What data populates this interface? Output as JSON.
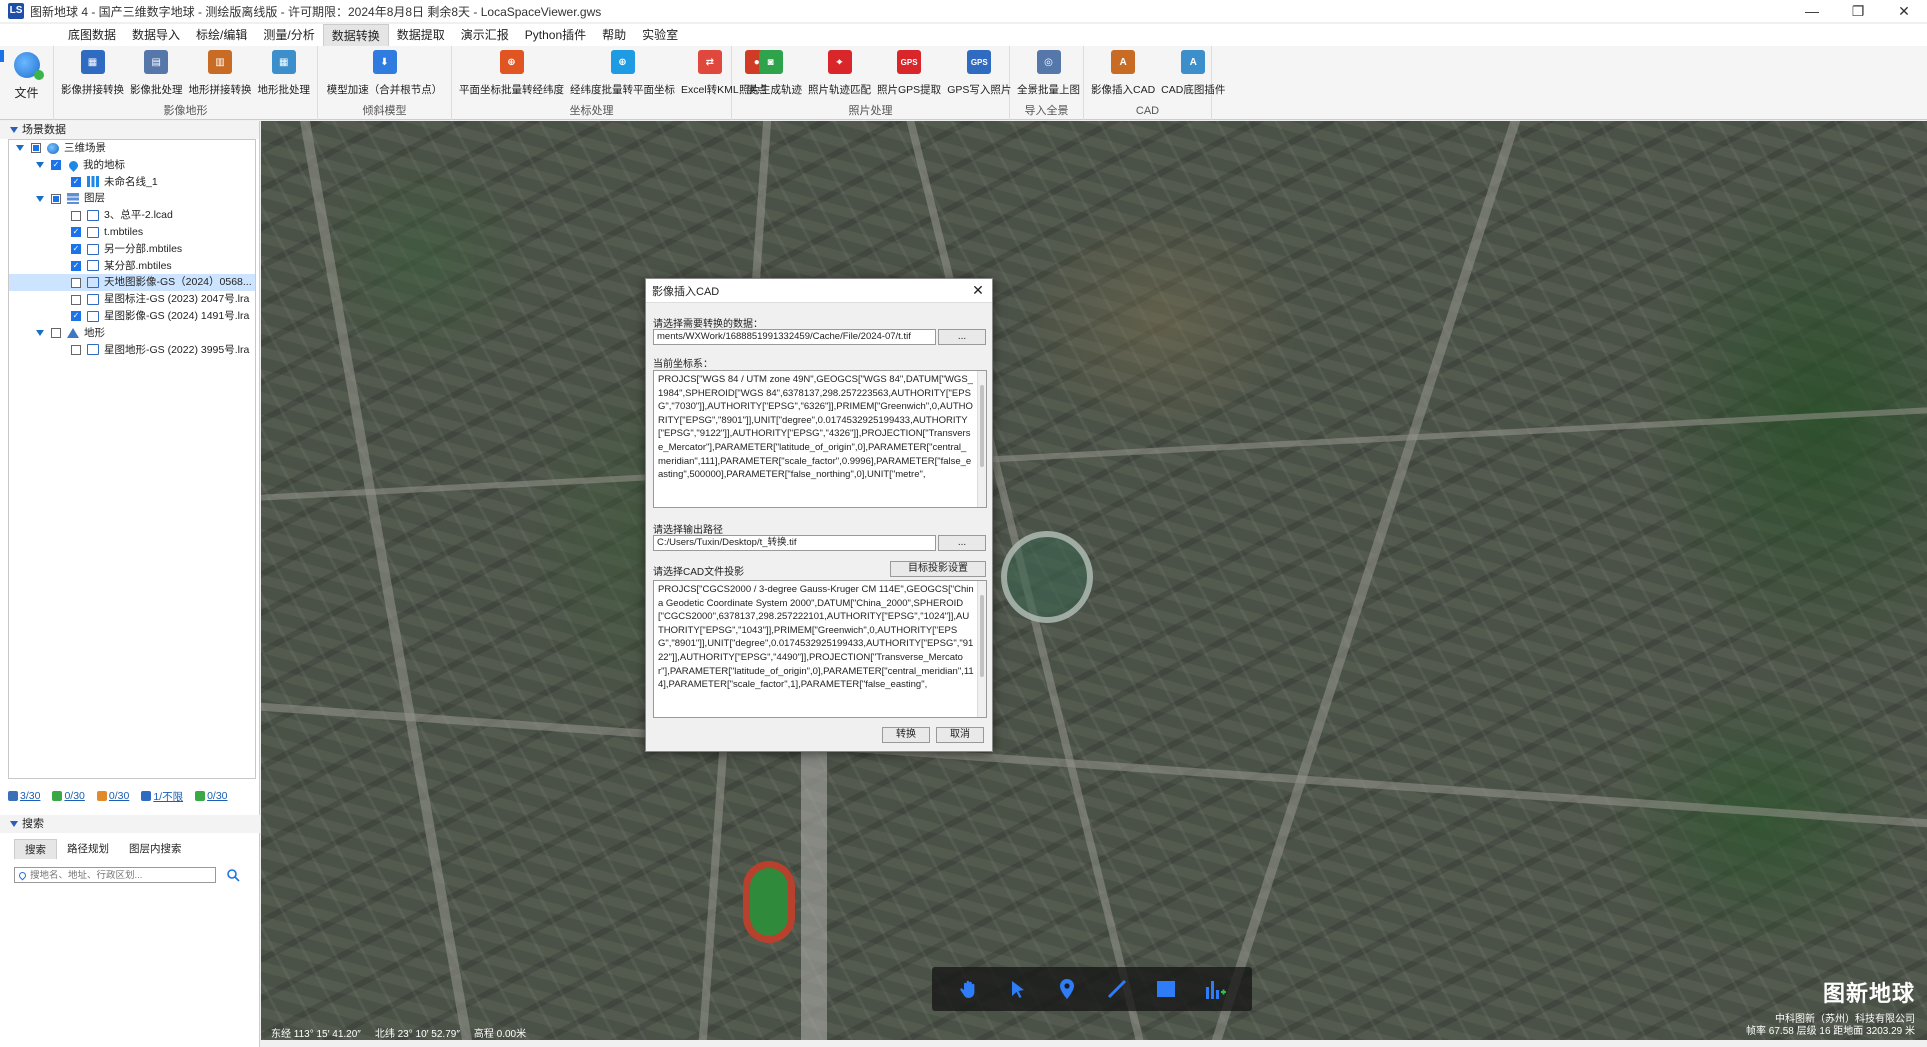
{
  "window": {
    "title": "图新地球 4 - 国产三维数字地球 - 测绘版离线版 - 许可期限：2024年8月8日 剩余8天 - LocaSpaceViewer.gws",
    "app_icon": "LS"
  },
  "menu": {
    "tabs": [
      "底图数据",
      "数据导入",
      "标绘/编辑",
      "测量/分析",
      "数据转换",
      "数据提取",
      "演示汇报",
      "Python插件",
      "帮助",
      "实验室"
    ],
    "active": "数据转换"
  },
  "ribbon": {
    "file_label": "文件",
    "groups": [
      {
        "name": "影像地形",
        "buttons": [
          "影像拼接转换",
          "影像批处理",
          "地形拼接转换",
          "地形批处理"
        ]
      },
      {
        "name": "倾斜模型",
        "buttons": [
          "模型加速（合并根节点）"
        ]
      },
      {
        "name": "坐标处理",
        "buttons": [
          "平面坐标批量转经纬度",
          "经纬度批量转平面坐标",
          "Excel转KML",
          "展点"
        ]
      },
      {
        "name": "照片处理",
        "buttons": [
          "照片生成轨迹",
          "照片轨迹匹配",
          "照片GPS提取",
          "GPS写入照片"
        ]
      },
      {
        "name": "导入全景",
        "buttons": [
          "全景批量上图"
        ]
      },
      {
        "name": "CAD",
        "buttons": [
          "影像插入CAD",
          "CAD底图插件"
        ]
      }
    ]
  },
  "left_panel": {
    "section_title": "场景数据",
    "tree": [
      {
        "label": "三维场景",
        "level": 0,
        "check": "partial",
        "icon": "globe",
        "expanded": true
      },
      {
        "label": "我的地标",
        "level": 1,
        "check": "checked",
        "icon": "pin",
        "expanded": true
      },
      {
        "label": "未命名线_1",
        "level": 2,
        "check": "checked",
        "icon": "bars"
      },
      {
        "label": "图层",
        "level": 1,
        "check": "partial",
        "icon": "stack",
        "expanded": true
      },
      {
        "label": "3、总平-2.lcad",
        "level": 2,
        "check": "unchecked",
        "icon": "layer"
      },
      {
        "label": "t.mbtiles",
        "level": 2,
        "check": "checked",
        "icon": "layer"
      },
      {
        "label": "另一分部.mbtiles",
        "level": 2,
        "check": "checked",
        "icon": "layer"
      },
      {
        "label": "某分部.mbtiles",
        "level": 2,
        "check": "checked",
        "icon": "layer"
      },
      {
        "label": "天地图影像-GS（2024）0568...",
        "level": 2,
        "check": "unchecked",
        "icon": "layer",
        "selected": true
      },
      {
        "label": "星图标注-GS (2023) 2047号.lra",
        "level": 2,
        "check": "unchecked",
        "icon": "layer"
      },
      {
        "label": "星图影像-GS (2024) 1491号.lra",
        "level": 2,
        "check": "checked",
        "icon": "layer"
      },
      {
        "label": "地形",
        "level": 1,
        "check": "unchecked",
        "icon": "mountain",
        "expanded": true
      },
      {
        "label": "星图地形-GS (2022) 3995号.lra",
        "level": 2,
        "check": "unchecked",
        "icon": "layer"
      }
    ],
    "stats": [
      {
        "value": "3/30",
        "color": "#3b6fb6"
      },
      {
        "value": "0/30",
        "color": "#3aa845"
      },
      {
        "value": "0/30",
        "color": "#e08a2a"
      },
      {
        "value": "1/不限",
        "color": "#2f6bc1"
      },
      {
        "value": "0/30",
        "color": "#3aa845"
      }
    ],
    "search": {
      "title": "搜索",
      "tabs": [
        "搜索",
        "路径规划",
        "图层内搜索"
      ],
      "active_tab": "搜索",
      "placeholder": "搜地名、地址、行政区划..."
    }
  },
  "map": {
    "brand": "图新地球",
    "brand_sub": "中科图新（苏州）科技有限公司",
    "status_left": [
      "东经 113° 15′ 41.20″",
      "北纬 23° 10′ 52.79″",
      "高程 0.00米"
    ],
    "status_right": "帧率 67.58  层级 16  距地面 3203.29 米",
    "tools": [
      "hand-icon",
      "pointer-icon",
      "pin-icon",
      "line-icon",
      "rect-icon",
      "chart-icon"
    ]
  },
  "dialog": {
    "title": "影像插入CAD",
    "select_label": "请选择需要转换的数据：",
    "input_path": "ments/WXWork/1688851991332459/Cache/File/2024-07/t.tif",
    "browse": "...",
    "current_crs_label": "当前坐标系：",
    "current_crs": "PROJCS[\"WGS 84 / UTM zone 49N\",GEOGCS[\"WGS 84\",DATUM[\"WGS_1984\",SPHEROID[\"WGS 84\",6378137,298.257223563,AUTHORITY[\"EPSG\",\"7030\"]],AUTHORITY[\"EPSG\",\"6326\"]],PRIMEM[\"Greenwich\",0,AUTHORITY[\"EPSG\",\"8901\"]],UNIT[\"degree\",0.0174532925199433,AUTHORITY[\"EPSG\",\"9122\"]],AUTHORITY[\"EPSG\",\"4326\"]],PROJECTION[\"Transverse_Mercator\"],PARAMETER[\"latitude_of_origin\",0],PARAMETER[\"central_meridian\",111],PARAMETER[\"scale_factor\",0.9996],PARAMETER[\"false_easting\",500000],PARAMETER[\"false_northing\",0],UNIT[\"metre\",",
    "output_label": "请选择输出路径",
    "output_path": "C:/Users/Tuxin/Desktop/t_转换.tif",
    "cad_proj_label": "请选择CAD文件投影",
    "target_proj_btn": "目标投影设置",
    "cad_crs": "PROJCS[\"CGCS2000 / 3-degree Gauss-Kruger CM 114E\",GEOGCS[\"China Geodetic Coordinate System 2000\",DATUM[\"China_2000\",SPHEROID[\"CGCS2000\",6378137,298.257222101,AUTHORITY[\"EPSG\",\"1024\"]],AUTHORITY[\"EPSG\",\"1043\"]],PRIMEM[\"Greenwich\",0,AUTHORITY[\"EPSG\",\"8901\"]],UNIT[\"degree\",0.0174532925199433,AUTHORITY[\"EPSG\",\"9122\"]],AUTHORITY[\"EPSG\",\"4490\"]],PROJECTION[\"Transverse_Mercator\"],PARAMETER[\"latitude_of_origin\",0],PARAMETER[\"central_meridian\",114],PARAMETER[\"scale_factor\",1],PARAMETER[\"false_easting\",",
    "convert": "转换",
    "cancel": "取消"
  }
}
